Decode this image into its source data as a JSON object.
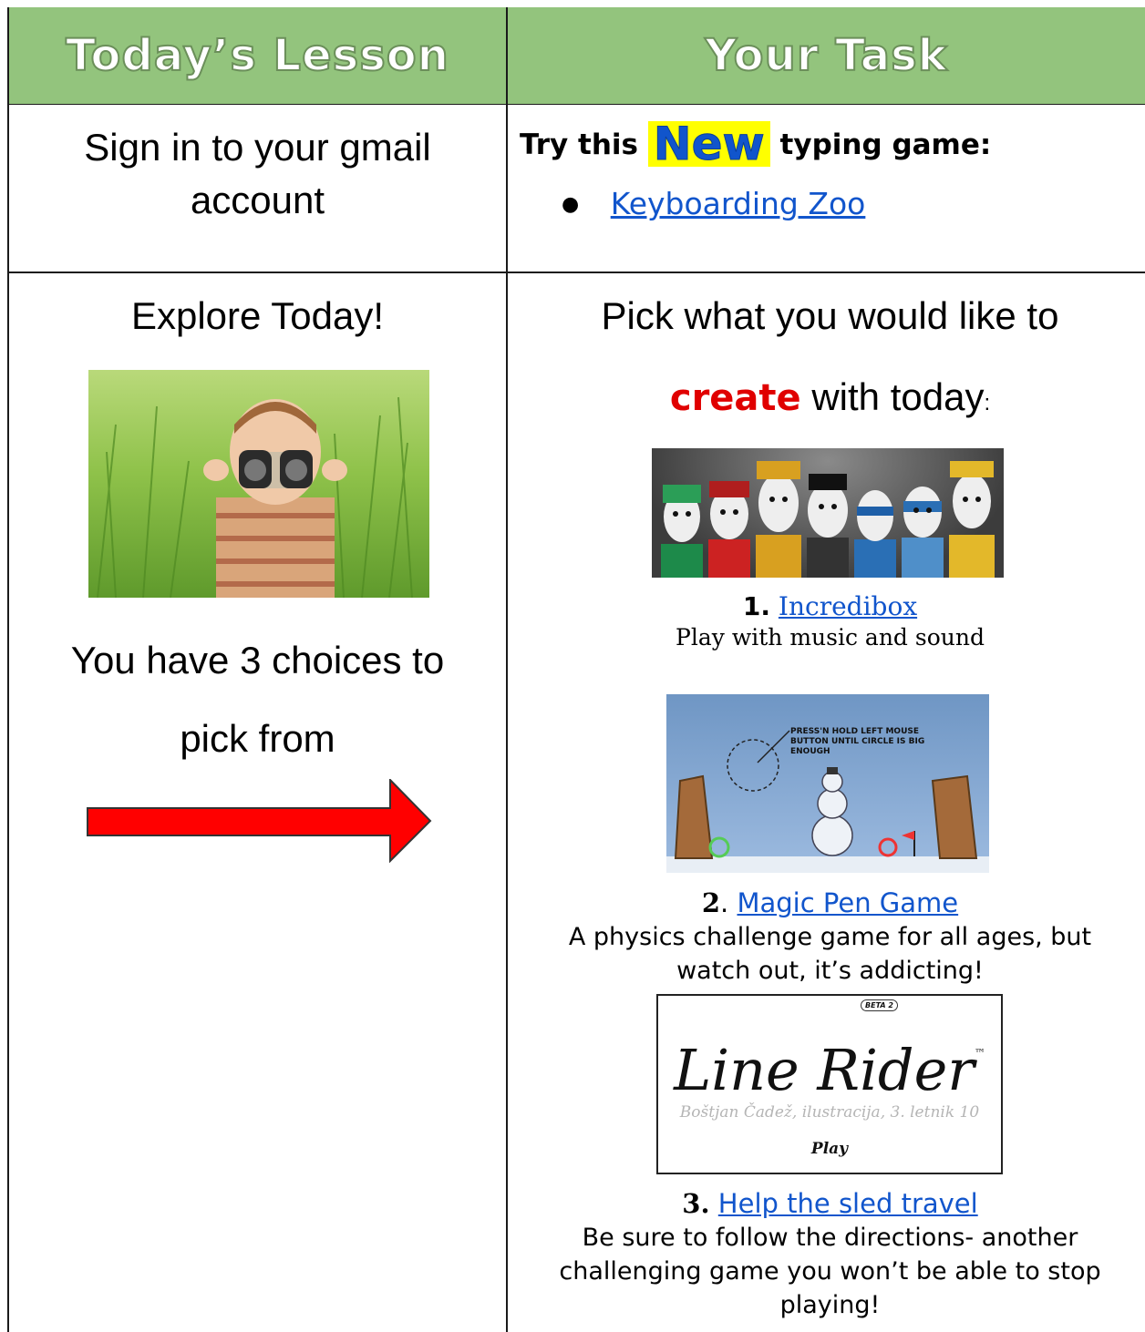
{
  "header": {
    "left_title": "Today’s Lesson",
    "right_title": "Your Task"
  },
  "row1": {
    "left_text": "Sign in to your gmail account",
    "right_prefix": "Try this",
    "new_badge": "New",
    "right_suffix": "typing game:",
    "bullet": "●",
    "link": "Keyboarding Zoo"
  },
  "row2": {
    "left": {
      "title": "Explore Today!",
      "choices_line1": "You have 3 choices to",
      "choices_line2": "pick from"
    },
    "right": {
      "intro_line1": "Pick what you would like to",
      "create_word": "create",
      "intro_line2_rest": "with today",
      "intro_colon": ":",
      "items": [
        {
          "number": "1.",
          "link": "Incredibox",
          "description": "Play with music and sound"
        },
        {
          "number": "2",
          "sep": ".",
          "link": "Magic Pen Game",
          "description_line1": "A physics challenge game for all ages, but",
          "description_line2": "watch out, it’s addicting!"
        },
        {
          "number": "3.",
          "link": "Help the sled travel",
          "description_line1": "Be sure to follow the directions- another",
          "description_line2": "challenging game you won’t be able to stop",
          "description_line3": "playing!"
        }
      ],
      "magic_pen_note": "PRESS'N HOLD LEFT MOUSE BUTTON UNTIL CIRCLE IS BIG ENOUGH",
      "line_rider_title": "Line Rider",
      "line_rider_tm": "™",
      "line_rider_beta": "BETA 2",
      "line_rider_credit": "Boštjan Čadež, ilustracija, 3. letnik 10",
      "line_rider_play": "Play"
    }
  },
  "colors": {
    "header_bg": "#93c47d",
    "link": "#1155cc",
    "highlight": "#ffff00",
    "create_red": "#e00000",
    "arrow_red": "#ff0000"
  }
}
